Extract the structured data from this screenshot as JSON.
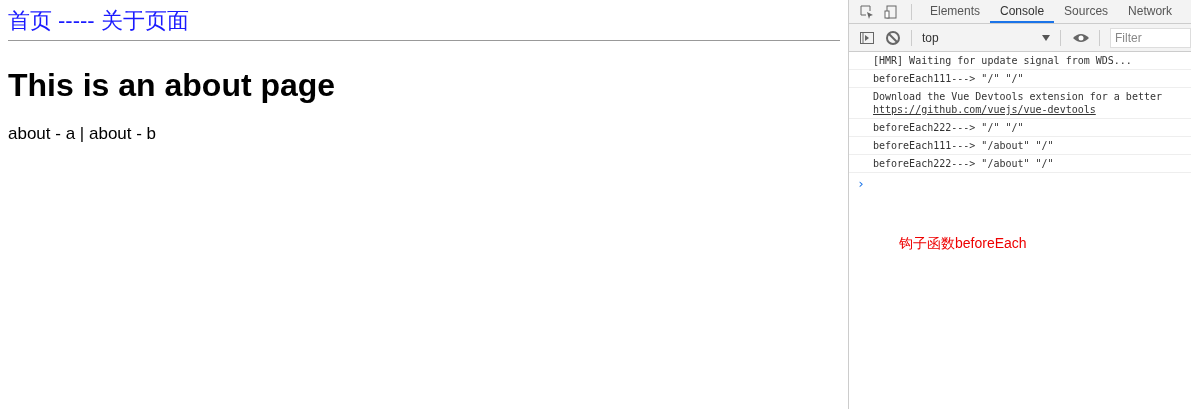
{
  "page": {
    "nav": {
      "links": [
        "首页",
        "关于页面"
      ],
      "separator": "-----"
    },
    "heading": "This is an about page",
    "sublinks": "about - a | about - b"
  },
  "devtools": {
    "tabs": [
      {
        "label": "Elements",
        "selected": false
      },
      {
        "label": "Console",
        "selected": true
      },
      {
        "label": "Sources",
        "selected": false
      },
      {
        "label": "Network",
        "selected": false
      }
    ],
    "context": "top",
    "filter": {
      "placeholder": "Filter"
    },
    "messages": [
      {
        "text": "[HMR] Waiting for update signal from WDS..."
      },
      {
        "text": "beforeEach111---> \"/\" \"/\""
      },
      {
        "text": "Download the Vue Devtools extension for a better",
        "link": "https://github.com/vuejs/vue-devtools"
      },
      {
        "text": "beforeEach222---> \"/\" \"/\""
      },
      {
        "text": "beforeEach111---> \"/about\" \"/\""
      },
      {
        "text": "beforeEach222---> \"/about\" \"/\""
      }
    ],
    "prompt": "›",
    "annotation": "钩子函数beforeEach"
  }
}
